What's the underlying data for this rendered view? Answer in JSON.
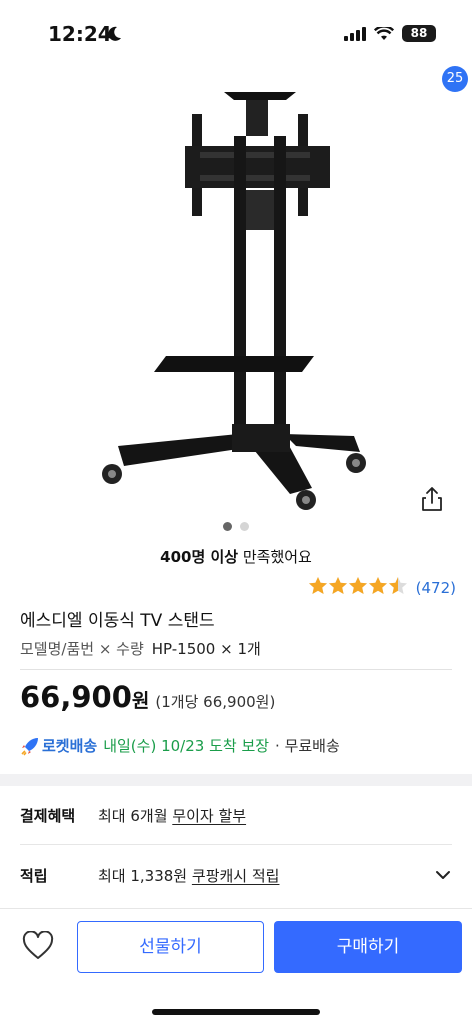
{
  "status": {
    "time": "12:24",
    "battery": "88"
  },
  "nav": {
    "cart_count": "25"
  },
  "gallery": {
    "total": 2,
    "active": 0
  },
  "satisfaction": {
    "bold": "400명 이상",
    "rest": " 만족했어요"
  },
  "rating": {
    "stars": 4.5,
    "count": "(472)"
  },
  "product": {
    "title": "에스디엘 이동식 TV 스탠드",
    "option_label": "모델명/품번 × 수량",
    "option_value": "HP-1500 × 1개"
  },
  "price": {
    "amount": "66,900",
    "unit": "원",
    "per_unit": "(1개당 66,900원)"
  },
  "delivery": {
    "rocket": "로켓배송",
    "date": "내일(수) 10/23 도착 보장",
    "fee": "· 무료배송"
  },
  "benefits": [
    {
      "key": "결제혜택",
      "text": "최대 6개월 ",
      "link": "무이자 할부"
    },
    {
      "key": "적립",
      "text": "최대 1,338원 ",
      "link": "쿠팡캐시 적립"
    }
  ],
  "actions": {
    "gift": "선물하기",
    "buy": "구매하기"
  },
  "colors": {
    "accent": "#346aff",
    "rating_star": "#f5a623",
    "delivery_green": "#1a9d4a"
  }
}
